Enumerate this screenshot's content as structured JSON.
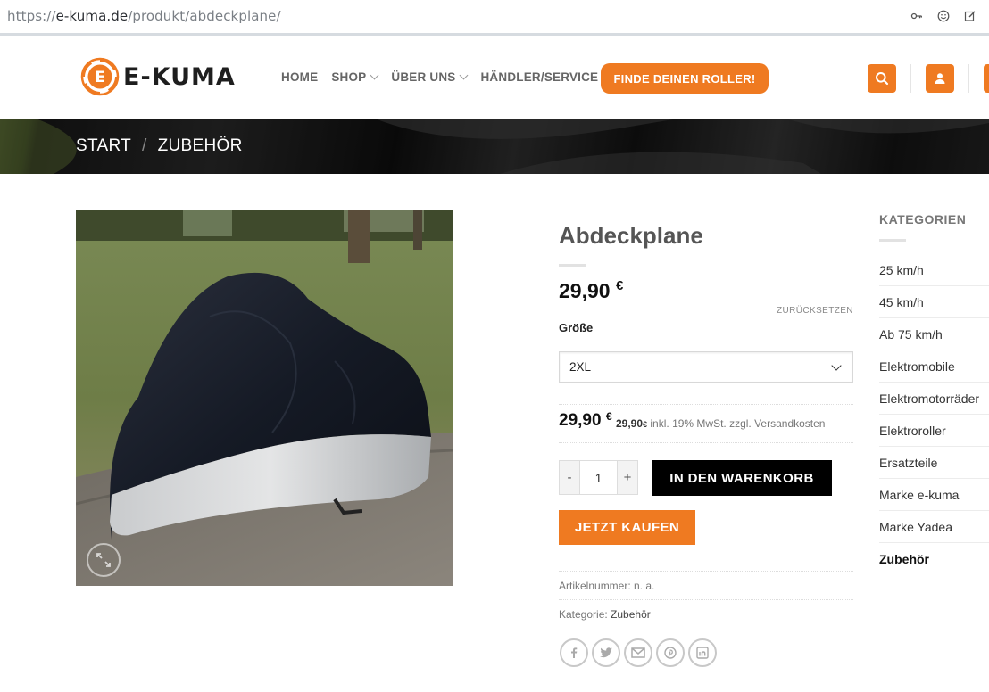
{
  "browser": {
    "url_prefix": "https://",
    "url_host": "e-kuma.de",
    "url_path": "/produkt/abdeckplane/"
  },
  "header": {
    "logo_text": "E-KUMA",
    "nav": [
      {
        "label": "HOME",
        "has_dropdown": false
      },
      {
        "label": "SHOP",
        "has_dropdown": true
      },
      {
        "label": "ÜBER UNS",
        "has_dropdown": true
      },
      {
        "label": "HÄNDLER/SERVICE",
        "has_dropdown": true
      }
    ],
    "cta_label": "FINDE DEINEN ROLLER!",
    "accent_color": "#ef7a21"
  },
  "breadcrumb": {
    "items": [
      "START",
      "ZUBEHÖR"
    ],
    "separator": "/"
  },
  "product": {
    "title": "Abdeckplane",
    "price": "29,90",
    "currency": "€",
    "reset_label": "ZURÜCKSETZEN",
    "size_label": "Größe",
    "size_selected": "2XL",
    "variant_price": "29,90",
    "tax_price": "29,90",
    "tax_text": "inkl. 19% MwSt. zzgl. Versandkosten",
    "quantity": "1",
    "qty_minus": "-",
    "qty_plus": "+",
    "add_to_cart_label": "IN DEN WARENKORB",
    "buy_now_label": "JETZT KAUFEN",
    "sku_label": "Artikelnummer:",
    "sku_value": "n. a.",
    "category_label": "Kategorie:",
    "category_value": "Zubehör"
  },
  "sidebar": {
    "title": "KATEGORIEN",
    "items": [
      "25 km/h",
      "45 km/h",
      "Ab 75 km/h",
      "Elektromobile",
      "Elektromotorräder",
      "Elektroroller",
      "Ersatzteile",
      "Marke e-kuma",
      "Marke Yadea",
      "Zubehör"
    ],
    "active_index": 9
  },
  "share_icons": [
    "facebook-icon",
    "twitter-icon",
    "email-icon",
    "pinterest-icon",
    "linkedin-icon"
  ]
}
